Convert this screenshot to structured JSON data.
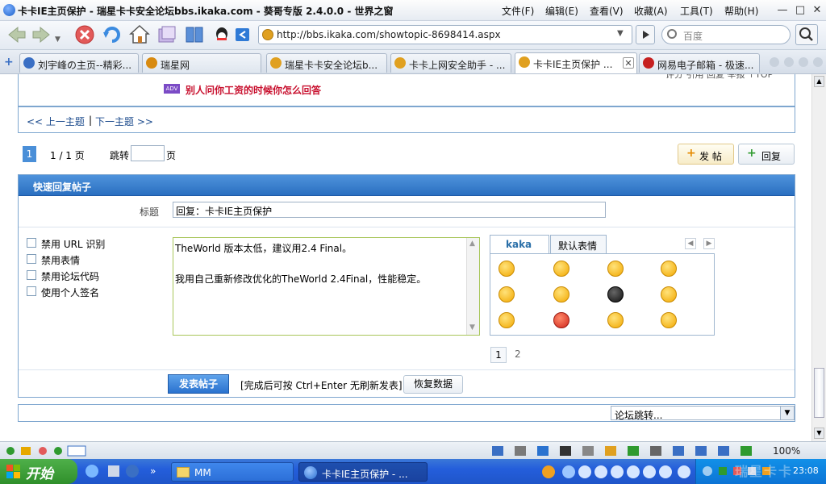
{
  "window": {
    "title": "卡卡IE主页保护 - 瑞星卡卡安全论坛bbs.ikaka.com - 葵哥专版 2.4.0.0 - 世界之窗",
    "menu": [
      "文件(F)",
      "编辑(E)",
      "查看(V)",
      "收藏(A)",
      "工具(T)",
      "帮助(H)"
    ]
  },
  "toolbar": {
    "address": "http://bbs.ikaka.com/showtopic-8698414.aspx",
    "search_placeholder": "百度"
  },
  "tabs": [
    {
      "label": "刘宇峰の主页--精彩...",
      "icon_color": "#3a6fc4"
    },
    {
      "label": "瑞星网",
      "icon_color": "#d88a10"
    },
    {
      "label": "瑞星卡卡安全论坛b...",
      "icon_color": "#e0a020"
    },
    {
      "label": "卡卡上网安全助手 - ...",
      "icon_color": "#e0a020"
    },
    {
      "label": "卡卡IE主页保护 ...",
      "icon_color": "#e0a020",
      "active": true
    },
    {
      "label": "网易电子邮箱 - 极速...",
      "icon_color": "#c62020"
    }
  ],
  "post": {
    "partial_right_text": "评分 引用 回复 举报 ↑TOP",
    "adv_badge": "ADV",
    "ad_text": "别人问你工资的时候你怎么回答",
    "prev_topic": "<< 上一主题",
    "separator": "|",
    "next_topic": "下一主题 >>"
  },
  "pager": {
    "current_page": "1",
    "page_info": "1 / 1 页",
    "jump_label": "跳转",
    "page_unit": "页",
    "new_post_label": "发 帖",
    "reply_label": "回复"
  },
  "quick_reply": {
    "header": "快速回复帖子",
    "title_label": "标题",
    "title_value": "回复：卡卡IE主页保护",
    "options": [
      "禁用 URL 识别",
      "禁用表情",
      "禁用论坛代码",
      "使用个人签名"
    ],
    "message_line1": "TheWorld 版本太低，建议用2.4 Final。",
    "message_line2": "我用自己重新修改优化的TheWorld 2.4Final，性能稳定。",
    "emoticon_tabs": [
      "kaka",
      "默认表情"
    ],
    "emoticon_pages": [
      "1",
      "2"
    ],
    "submit_label": "发表帖子",
    "hint": "[完成后可按 Ctrl+Enter 无刷新发表]",
    "restore_label": "恢复数据"
  },
  "forum_jump": {
    "label": "论坛跳转..."
  },
  "status": {
    "zoom": "100%"
  },
  "taskbar": {
    "start_label": "开始",
    "tasks": [
      "MM",
      "卡卡IE主页保护 - ..."
    ],
    "clock": "23:08",
    "watermark": "瑞星卡卡"
  }
}
